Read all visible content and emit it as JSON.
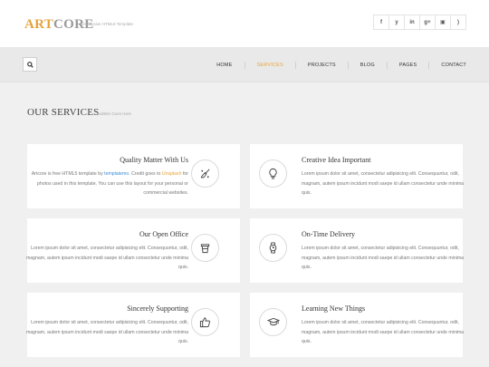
{
  "header": {
    "logo_primary": "ART",
    "logo_secondary": "CORE",
    "tagline": "Responsive HTML5 Template",
    "social": [
      {
        "icon": "facebook-icon",
        "glyph": "f"
      },
      {
        "icon": "twitter-icon",
        "glyph": "y"
      },
      {
        "icon": "linkedin-icon",
        "glyph": "in"
      },
      {
        "icon": "googleplus-icon",
        "glyph": "g+"
      },
      {
        "icon": "flickr-icon",
        "glyph": "▣"
      },
      {
        "icon": "rss-icon",
        "glyph": ")"
      }
    ]
  },
  "nav": {
    "items": [
      "HOME",
      "SERVICES",
      "PROJECTS",
      "BLOG",
      "PAGES",
      "CONTACT"
    ],
    "active": "SERVICES"
  },
  "section": {
    "title": "OUR SERVICES",
    "subtitle": "Subtitle Goes Here"
  },
  "services": [
    {
      "title": "Quality Matter With Us",
      "desc_parts": [
        "Artcore is free HTML5 template by ",
        "templatemo",
        ". Credit goes to ",
        "Unsplash",
        " for photos used in this template. You can use this layout for your personal or commercial websites."
      ],
      "icon": "paint-brush-icon"
    },
    {
      "title": "Creative Idea Important",
      "desc": "Lorem ipsum dolor sit amet, consectetur adipisicing elit. Consequuntur, odit, magnam, autem ipsum incidunt modi saepe id ullam consectetur unde minima quis.",
      "icon": "lightbulb-icon"
    },
    {
      "title": "Our Open Office",
      "desc": "Lorem ipsum dolor sit amet, consectetur adipisicing elit. Consequuntur, odit, magnam, autem ipsum incidunt modi saepe id ullam consectetur unde minima quis.",
      "icon": "coffee-cup-icon"
    },
    {
      "title": "On-Time Delivery",
      "desc": "Lorem ipsum dolor sit amet, consectetur adipisicing elit. Consequuntur, odit, magnam, autem ipsum incidunt modi saepe id ullam consectetur unde minima quis.",
      "icon": "watch-icon"
    },
    {
      "title": "Sincerely Supporting",
      "desc": "Lorem ipsum dolor sit amet, consectetur adipisicing elit. Consequuntur, odit, magnam, autem ipsum incidunt modi saepe id ullam consectetur unde minima quis.",
      "icon": "thumbs-up-icon"
    },
    {
      "title": "Learning New Things",
      "desc": "Lorem ipsum dolor sit amet, consectetur adipisicing elit. Consequuntur, odit, magnam, autem ipsum incidunt modi saepe id ullam consectetur unde minima quis.",
      "icon": "graduation-cap-icon"
    }
  ],
  "colors": {
    "accent": "#e6a33a",
    "link_blue": "#3b8ed6",
    "page_bg": "#f0f0f0",
    "card_bg": "#ffffff"
  }
}
